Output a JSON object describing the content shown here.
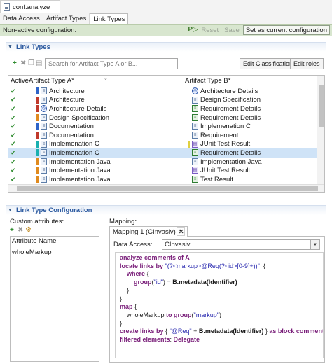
{
  "window": {
    "title": "conf.analyze"
  },
  "tabs": [
    "Data Access",
    "Artifact Types",
    "Link Types"
  ],
  "status": {
    "text": "Non-active configuration.",
    "reset": "Reset",
    "save": "Save",
    "set_current": "Set as current configuration"
  },
  "link_types": {
    "section_title": "Link Types",
    "search_placeholder": "Search for Artifact Type A or B...",
    "edit_classifications": "Edit Classifications",
    "edit_roles": "Edit roles",
    "headers": {
      "active": "Active",
      "a": "Artifact Type A*",
      "b": "Artifact Type B*"
    },
    "rows": [
      {
        "a": "Architecture",
        "b": "Architecture Details",
        "ia": "doc",
        "ib": "blue",
        "ca": "#2e64c8",
        "cb": ""
      },
      {
        "a": "Architecture",
        "b": "Design Specification",
        "ia": "doc",
        "ib": "doc",
        "ca": "#c0392b",
        "cb": ""
      },
      {
        "a": "Architecture Details",
        "b": "Requirement Details",
        "ia": "blue",
        "ib": "green",
        "ca": "#c0392b",
        "cb": ""
      },
      {
        "a": "Design Specification",
        "b": "Requirement Details",
        "ia": "doc",
        "ib": "green",
        "ca": "#e08a1e",
        "cb": ""
      },
      {
        "a": "Documentation",
        "b": "Implemenation C",
        "ia": "doc",
        "ib": "doc",
        "ca": "#2e64c8",
        "cb": ""
      },
      {
        "a": "Documentation",
        "b": "Requirement",
        "ia": "doc",
        "ib": "doc",
        "ca": "#c0392b",
        "cb": ""
      },
      {
        "a": "Implemenation C",
        "b": "JUnit Test Result",
        "ia": "doc",
        "ib": "purple",
        "ca": "#1ab0b0",
        "cb": "#e0d040"
      },
      {
        "a": "Implemenation C",
        "b": "Requirement Details",
        "ia": "doc",
        "ib": "green",
        "ca": "#1ab0b0",
        "cb": ""
      },
      {
        "a": "Implementation Java",
        "b": "Implementation Java",
        "ia": "doc",
        "ib": "doc",
        "ca": "#e08a1e",
        "cb": ""
      },
      {
        "a": "Implementation Java",
        "b": "JUnit Test Result",
        "ia": "doc",
        "ib": "purple",
        "ca": "#e08a1e",
        "cb": ""
      },
      {
        "a": "Implementation Java",
        "b": "Test Result",
        "ia": "doc",
        "ib": "green",
        "ca": "#e08a1e",
        "cb": ""
      }
    ],
    "selected_index": 7
  },
  "config": {
    "section_title": "Link Type Configuration",
    "custom_attributes_label": "Custom attributes:",
    "attr_header": "Attribute Name",
    "attributes": [
      "wholeMarkup"
    ],
    "mapping_label": "Mapping:",
    "mapping_tab": "Mapping 1 (CInvasiv)",
    "add_tab": "+",
    "data_access_label": "Data Access:",
    "data_access_value": "CInvasiv"
  },
  "code_lines": [
    [
      [
        "kw",
        "analyze comments of A"
      ]
    ],
    [
      [
        "kw",
        "locate links by "
      ],
      [
        "str",
        "\"(?<markup>@Req(?<id>[0-9]+))\""
      ],
      [
        "",
        "  {"
      ]
    ],
    [
      [
        "",
        "    "
      ],
      [
        "kw",
        "where"
      ],
      [
        "",
        " {"
      ]
    ],
    [
      [
        "",
        "        "
      ],
      [
        "kw",
        "group"
      ],
      [
        "",
        "("
      ],
      [
        "str",
        "\"id\""
      ],
      [
        "",
        ") = "
      ],
      [
        "fn",
        "B.metadata(Identifier)"
      ]
    ],
    [
      [
        "",
        "    }"
      ]
    ],
    [
      [
        "",
        "}"
      ]
    ],
    [
      [
        "kw",
        "map"
      ],
      [
        "",
        " {"
      ]
    ],
    [
      [
        "",
        "    wholeMarkup "
      ],
      [
        "kw",
        "to"
      ],
      [
        "",
        " "
      ],
      [
        "kw",
        "group"
      ],
      [
        "",
        "("
      ],
      [
        "str",
        "\"markup\""
      ],
      [
        "",
        ")"
      ]
    ],
    [
      [
        "",
        "}"
      ]
    ],
    [
      [
        "kw",
        "create links by"
      ],
      [
        "",
        " { "
      ],
      [
        "str",
        "\"@Req\""
      ],
      [
        "",
        " + "
      ],
      [
        "fn",
        "B.metadata(Identifier)"
      ],
      [
        "",
        " } "
      ],
      [
        "kw",
        "as block comment"
      ]
    ],
    [
      [
        "kw",
        "filtered elements"
      ],
      [
        "",
        ": "
      ],
      [
        "kw",
        "Delegate"
      ]
    ]
  ]
}
